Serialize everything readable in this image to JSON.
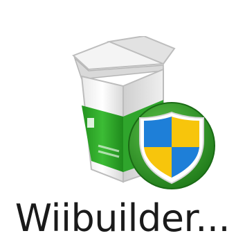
{
  "desktop": {
    "icon": {
      "label": "Wiibuilder...",
      "icon_name": "installer-box-with-uac-shield-icon",
      "colors": {
        "box_green": "#2fa52c",
        "box_white": "#f2f2f2",
        "shield_blue": "#1e7fd8",
        "shield_yellow": "#f7c50c",
        "badge_green": "#3a9b2a"
      }
    }
  }
}
